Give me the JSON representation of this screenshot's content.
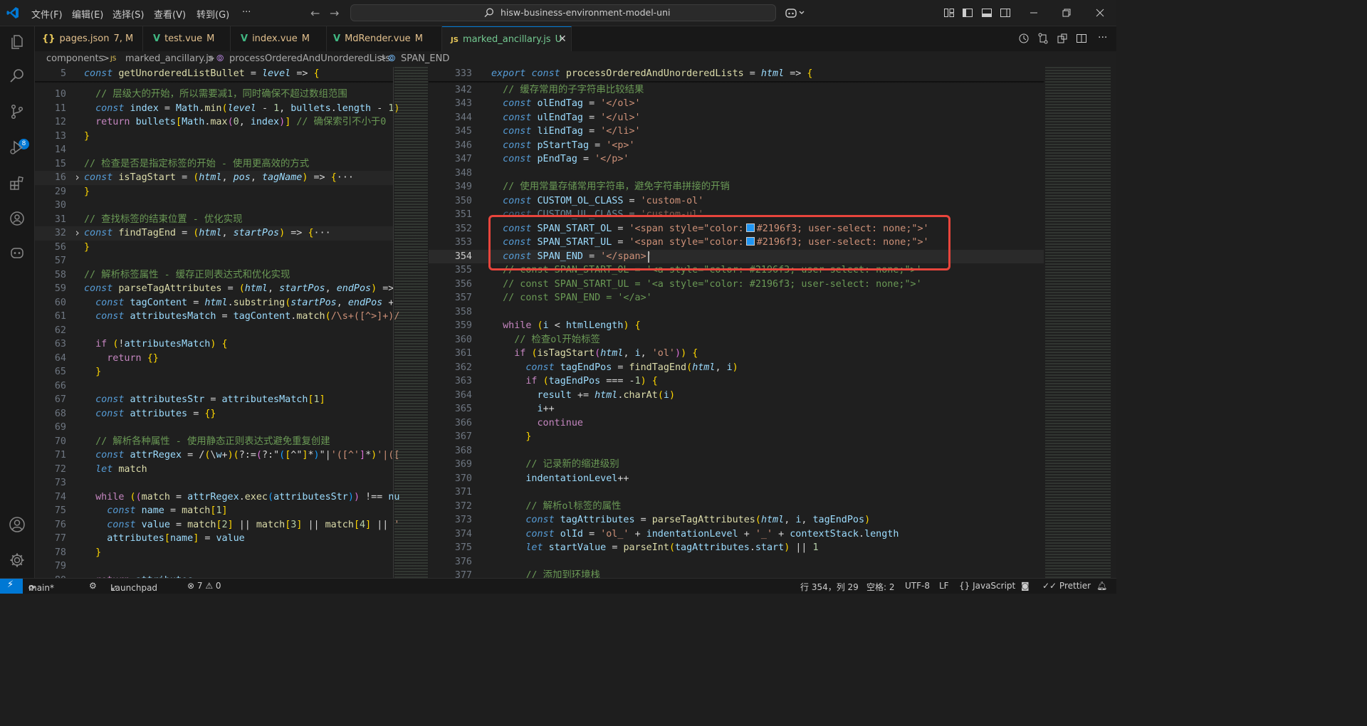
{
  "menu": [
    "文件(F)",
    "编辑(E)",
    "选择(S)",
    "查看(V)",
    "转到(G)",
    "···"
  ],
  "search": {
    "text": "hisw-business-environment-model-uni"
  },
  "tabs": [
    {
      "icon": "{}",
      "label": "pages.json",
      "status": "7, M",
      "color": "#e2c08d"
    },
    {
      "icon": "V",
      "label": "test.vue",
      "status": "M",
      "color": "#e2c08d"
    },
    {
      "icon": "V",
      "label": "index.vue",
      "status": "M",
      "color": "#e2c08d"
    },
    {
      "icon": "V",
      "label": "MdRender.vue",
      "status": "M",
      "color": "#e2c08d"
    },
    {
      "icon": "JS",
      "label": "marked_ancillary.js",
      "status": "U",
      "color": "#73c991"
    }
  ],
  "breadcrumb": [
    "components",
    ">",
    "marked_ancillary.js",
    ">",
    "processOrderedAndUnorderedLists",
    ">",
    "SPAN_END"
  ],
  "scm_badge": "8",
  "left_editor": {
    "sticky": {
      "num": "5",
      "text": "const getUnorderedListBullet = level => {"
    },
    "lines": [
      {
        "num": "10",
        "text": "  // 层级大的开始，所以需要减1，同时确保不超过数组范围"
      },
      {
        "num": "11",
        "text": "  const index = Math.min(level - 1, bullets.length - 1)"
      },
      {
        "num": "12",
        "text": "  return bullets[Math.max(0, index)] // 确保索引不小于0"
      },
      {
        "num": "13",
        "text": "}"
      },
      {
        "num": "14",
        "text": ""
      },
      {
        "num": "15",
        "text": "// 检查是否是指定标签的开始 - 使用更高效的方式"
      },
      {
        "num": "16",
        "text": "const isTagStart = (html, pos, tagName) => {···"
      },
      {
        "num": "29",
        "text": "}"
      },
      {
        "num": "30",
        "text": ""
      },
      {
        "num": "31",
        "text": "// 查找标签的结束位置 - 优化实现"
      },
      {
        "num": "32",
        "text": "const findTagEnd = (html, startPos) => {···"
      },
      {
        "num": "56",
        "text": "}"
      },
      {
        "num": "57",
        "text": ""
      },
      {
        "num": "58",
        "text": "// 解析标签属性 - 缓存正则表达式和优化实现"
      },
      {
        "num": "59",
        "text": "const parseTagAttributes = (html, startPos, endPos) =>"
      },
      {
        "num": "60",
        "text": "  const tagContent = html.substring(startPos, endPos +"
      },
      {
        "num": "61",
        "text": "  const attributesMatch = tagContent.match(/\\s+([^>]+)/"
      },
      {
        "num": "62",
        "text": ""
      },
      {
        "num": "63",
        "text": "  if (!attributesMatch) {"
      },
      {
        "num": "64",
        "text": "    return {}"
      },
      {
        "num": "65",
        "text": "  }"
      },
      {
        "num": "66",
        "text": ""
      },
      {
        "num": "67",
        "text": "  const attributesStr = attributesMatch[1]"
      },
      {
        "num": "68",
        "text": "  const attributes = {}"
      },
      {
        "num": "69",
        "text": ""
      },
      {
        "num": "70",
        "text": "  // 解析各种属性 - 使用静态正则表达式避免重复创建"
      },
      {
        "num": "71",
        "text": "  const attrRegex = /(\\w+)(?:=(?:\"([^\"]*)\"|'([^']*)'|(["
      },
      {
        "num": "72",
        "text": "  let match"
      },
      {
        "num": "73",
        "text": ""
      },
      {
        "num": "74",
        "text": "  while ((match = attrRegex.exec(attributesStr)) !== nu"
      },
      {
        "num": "75",
        "text": "    const name = match[1]"
      },
      {
        "num": "76",
        "text": "    const value = match[2] || match[3] || match[4] || '"
      },
      {
        "num": "77",
        "text": "    attributes[name] = value"
      },
      {
        "num": "78",
        "text": "  }"
      },
      {
        "num": "79",
        "text": ""
      },
      {
        "num": "80",
        "text": "  return attributes"
      }
    ]
  },
  "right_editor": {
    "sticky": {
      "num": "333",
      "text": "export const processOrderedAndUnorderedLists = html => {"
    },
    "lines": [
      {
        "num": "342",
        "text": "  // 缓存常用的子字符串比较结果"
      },
      {
        "num": "343",
        "text": "  const olEndTag = '</ol>'"
      },
      {
        "num": "344",
        "text": "  const ulEndTag = '</ul>'"
      },
      {
        "num": "345",
        "text": "  const liEndTag = '</li>'"
      },
      {
        "num": "346",
        "text": "  const pStartTag = '<p>'"
      },
      {
        "num": "347",
        "text": "  const pEndTag = '</p>'"
      },
      {
        "num": "348",
        "text": ""
      },
      {
        "num": "349",
        "text": "  // 使用常量存储常用字符串，避免字符串拼接的开销"
      },
      {
        "num": "350",
        "text": "  const CUSTOM_OL_CLASS = 'custom-ol'"
      },
      {
        "num": "351",
        "text": "  const CUSTOM_UL_CLASS = 'custom-ul'"
      },
      {
        "num": "352",
        "text": "  const SPAN_START_OL = '<span style=\"color: #2196f3; user-select: none;\">'"
      },
      {
        "num": "353",
        "text": "  const SPAN_START_UL = '<span style=\"color: #2196f3; user-select: none;\">'"
      },
      {
        "num": "354",
        "text": "  const SPAN_END = '</span>'"
      },
      {
        "num": "355",
        "text": "  // const SPAN_START_OL = '<a style=\"color: #2196f3; user-select: none;\">'"
      },
      {
        "num": "356",
        "text": "  // const SPAN_START_UL = '<a style=\"color: #2196f3; user-select: none;\">'"
      },
      {
        "num": "357",
        "text": "  // const SPAN_END = '</a>'"
      },
      {
        "num": "358",
        "text": ""
      },
      {
        "num": "359",
        "text": "  while (i < htmlLength) {"
      },
      {
        "num": "360",
        "text": "    // 检查ol开始标签"
      },
      {
        "num": "361",
        "text": "    if (isTagStart(html, i, 'ol')) {"
      },
      {
        "num": "362",
        "text": "      const tagEndPos = findTagEnd(html, i)"
      },
      {
        "num": "363",
        "text": "      if (tagEndPos === -1) {"
      },
      {
        "num": "364",
        "text": "        result += html.charAt(i)"
      },
      {
        "num": "365",
        "text": "        i++"
      },
      {
        "num": "366",
        "text": "        continue"
      },
      {
        "num": "367",
        "text": "      }"
      },
      {
        "num": "368",
        "text": ""
      },
      {
        "num": "369",
        "text": "      // 记录新的缩进级别"
      },
      {
        "num": "370",
        "text": "      indentationLevel++"
      },
      {
        "num": "371",
        "text": ""
      },
      {
        "num": "372",
        "text": "      // 解析ol标签的属性"
      },
      {
        "num": "373",
        "text": "      const tagAttributes = parseTagAttributes(html, i, tagEndPos)"
      },
      {
        "num": "374",
        "text": "      const olId = 'ol_' + indentationLevel + '_' + contextStack.length"
      },
      {
        "num": "375",
        "text": "      let startValue = parseInt(tagAttributes.start) || 1"
      },
      {
        "num": "376",
        "text": ""
      },
      {
        "num": "377",
        "text": "      // 添加到环境栈"
      }
    ]
  },
  "statusbar": {
    "branch": "main*",
    "launchpad": "Launchpad",
    "problems": "⊗ 7 ⚠ 0",
    "position": "行 354，列 29",
    "spaces": "空格: 2",
    "encoding": "UTF-8",
    "eol": "LF",
    "language": "{} JavaScript",
    "prettier": "✓✓ Prettier"
  },
  "colors": {
    "accent": "#0078d4",
    "highlight_box": "#e8453c",
    "swatch": "#2196f3"
  }
}
